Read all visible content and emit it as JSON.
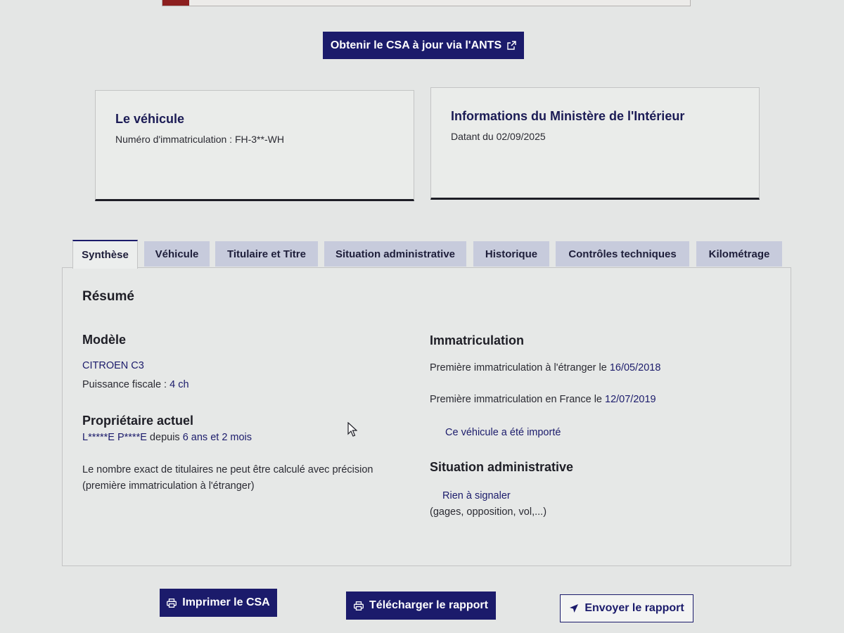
{
  "top_button": {
    "label": "Obtenir le CSA à jour via l'ANTS",
    "icon": "external-link-icon"
  },
  "vehicle_card": {
    "title": "Le véhicule",
    "plate_text": "Numéro d'immatriculation : FH-3**-WH"
  },
  "ministry_card": {
    "title": "Informations du Ministère de l'Intérieur",
    "date_text": "Datant du 02/09/2025"
  },
  "tabs": [
    {
      "label": "Synthèse",
      "active": true
    },
    {
      "label": "Véhicule"
    },
    {
      "label": "Titulaire et Titre"
    },
    {
      "label": "Situation administrative"
    },
    {
      "label": "Historique"
    },
    {
      "label": "Contrôles techniques"
    },
    {
      "label": "Kilométrage"
    }
  ],
  "summary": {
    "heading": "Résumé",
    "model": {
      "heading": "Modèle",
      "name": "CITROEN C3",
      "fiscal_power_label": "Puissance fiscale : ",
      "fiscal_power_value": "4 ch"
    },
    "owner": {
      "heading": "Propriétaire actuel",
      "name": "L*****E P****E",
      "since_label": " depuis ",
      "since_value": "6 ans et 2 mois",
      "note_line1": "Le nombre exact de titulaires ne peut être calculé avec précision",
      "note_line2": "(première immatriculation à l'étranger)"
    },
    "registration": {
      "heading": "Immatriculation",
      "foreign_label": "Première immatriculation à l'étranger le ",
      "foreign_date": "16/05/2018",
      "france_label": "Première immatriculation en France le ",
      "france_date": "12/07/2019",
      "imported_text": "Ce véhicule a été importé"
    },
    "admin": {
      "heading": "Situation administrative",
      "status": "Rien à signaler",
      "details": "(gages, opposition, vol,...)"
    }
  },
  "bottom_buttons": {
    "print": {
      "label": "Imprimer le CSA",
      "icon": "printer-icon"
    },
    "download": {
      "label": "Télécharger le rapport",
      "icon": "printer-icon"
    },
    "send": {
      "label": "Envoyer le rapport",
      "icon": "send-arrow-icon"
    }
  },
  "colors": {
    "primary": "#1b1b6b",
    "tab_inactive": "#c7cbdc",
    "alert_accent": "#8c1f1f"
  }
}
